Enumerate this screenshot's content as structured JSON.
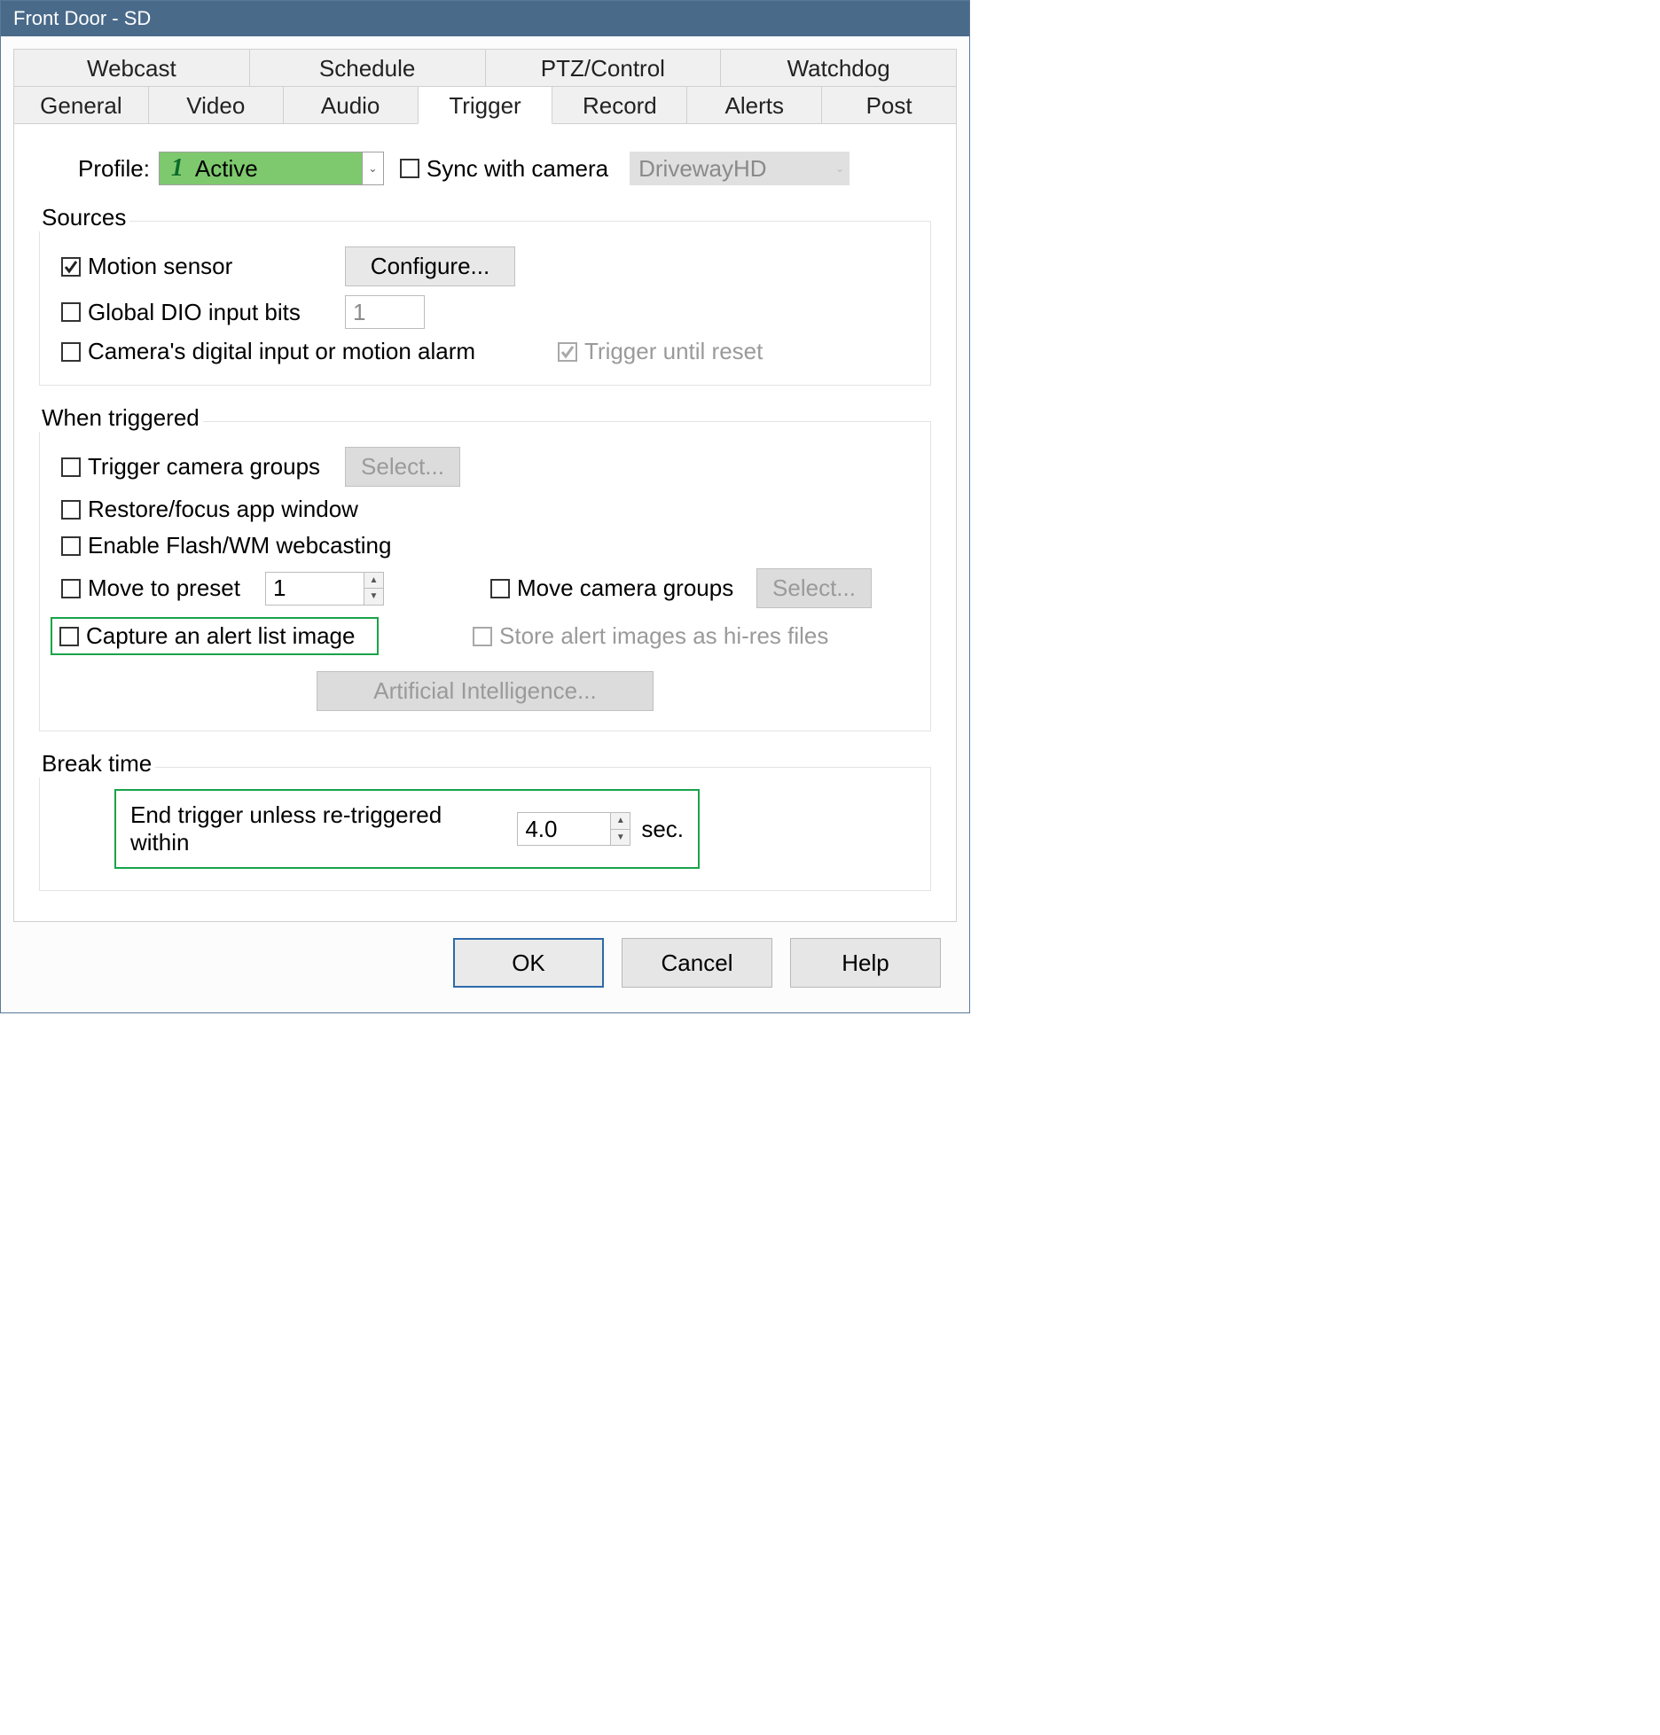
{
  "windowTitle": "Front Door - SD",
  "tabsTop": [
    "Webcast",
    "Schedule",
    "PTZ/Control",
    "Watchdog"
  ],
  "tabsBottom": [
    "General",
    "Video",
    "Audio",
    "Trigger",
    "Record",
    "Alerts",
    "Post"
  ],
  "activeTab": "Trigger",
  "profile": {
    "label": "Profile:",
    "num": "1",
    "text": "Active",
    "syncLabel": "Sync with camera",
    "syncChecked": false,
    "cameraName": "DrivewayHD"
  },
  "sources": {
    "title": "Sources",
    "motion": {
      "label": "Motion sensor",
      "checked": true
    },
    "configureBtn": "Configure...",
    "globalDIO": {
      "label": "Global DIO input bits",
      "checked": false,
      "value": "1"
    },
    "camDigital": {
      "label": "Camera's digital input or motion alarm",
      "checked": false
    },
    "triggerUntil": {
      "label": "Trigger until reset",
      "checked": true
    }
  },
  "whenTriggered": {
    "title": "When triggered",
    "triggerGroups": {
      "label": "Trigger camera groups",
      "checked": false
    },
    "selectBtn1": "Select...",
    "restoreFocus": {
      "label": "Restore/focus app window",
      "checked": false
    },
    "enableFlash": {
      "label": "Enable Flash/WM webcasting",
      "checked": false
    },
    "movePreset": {
      "label": "Move to preset",
      "checked": false,
      "value": "1"
    },
    "moveGroups": {
      "label": "Move camera groups",
      "checked": false
    },
    "selectBtn2": "Select...",
    "captureAlert": {
      "label": "Capture an alert list image",
      "checked": false
    },
    "storeHires": {
      "label": "Store alert images as hi-res files",
      "checked": false
    },
    "aiBtn": "Artificial Intelligence..."
  },
  "breakTime": {
    "title": "Break time",
    "text1": "End trigger unless re-triggered within",
    "value": "4.0",
    "text2": "sec."
  },
  "footer": {
    "ok": "OK",
    "cancel": "Cancel",
    "help": "Help"
  }
}
